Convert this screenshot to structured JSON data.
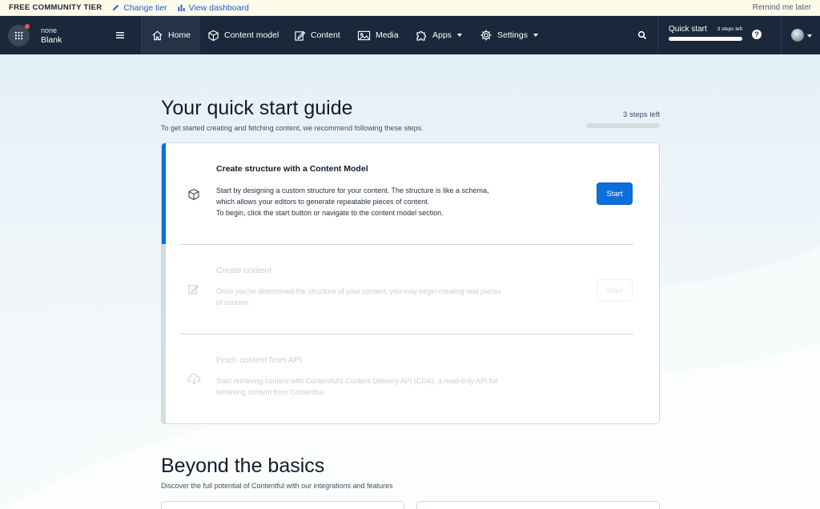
{
  "tier_bar": {
    "label": "FREE COMMUNITY TIER",
    "change_tier": "Change tier",
    "view_dashboard": "View dashboard",
    "remind": "Remind me later"
  },
  "nav": {
    "space_env": "none",
    "space_name": "Blank",
    "items": [
      {
        "label": "Home",
        "icon": "home-icon"
      },
      {
        "label": "Content model",
        "icon": "content-model-icon"
      },
      {
        "label": "Content",
        "icon": "content-icon"
      },
      {
        "label": "Media",
        "icon": "media-icon"
      },
      {
        "label": "Apps",
        "icon": "apps-icon"
      },
      {
        "label": "Settings",
        "icon": "settings-icon"
      }
    ],
    "quick_start": "Quick start",
    "quick_start_steps": "3 steps left",
    "help": "?"
  },
  "guide": {
    "title": "Your quick start guide",
    "subtitle": "To get started creating and fetching content, we recommend following these steps.",
    "steps_left": "3 steps left",
    "steps_progress": 0,
    "steps": [
      {
        "title": "Create structure with a Content Model",
        "desc1": "Start by designing a custom structure for your content. The structure is like a schema,",
        "desc2": "which allows your editors to generate repeatable pieces of content.",
        "desc3": "To begin, click the start button or navigate to the content model section.",
        "button": "Start"
      },
      {
        "title": "Create content",
        "desc1": "Once you've determined the structure of your content, you may begin creating real pieces",
        "desc2": "of content.",
        "button": "Start"
      },
      {
        "title": "Fetch content from API",
        "desc1": "Start retrieving content with Contentful's Content Delivery API (CDA), a read-only API for",
        "desc2": "retrieving content from Contentful."
      }
    ]
  },
  "beyond": {
    "title": "Beyond the basics",
    "subtitle": "Discover the full potential of Contentful with our integrations and features"
  },
  "colors": {
    "nav_bg": "#1b273a",
    "accent": "#0c6fdc",
    "banner_bg": "#fdfbea"
  }
}
